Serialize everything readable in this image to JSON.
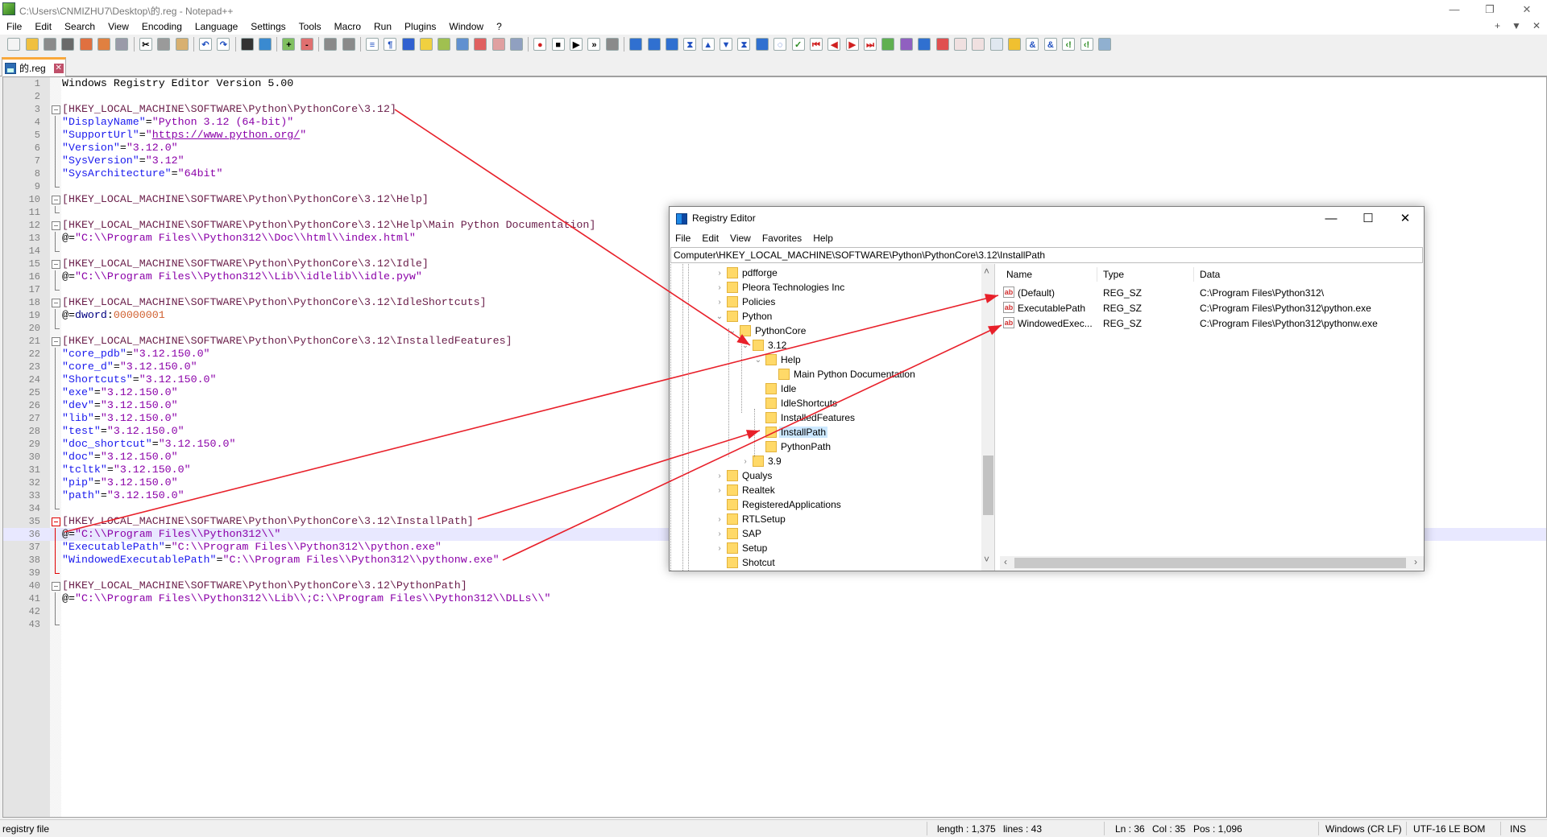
{
  "window": {
    "title": "C:\\Users\\CNMIZHU7\\Desktop\\的.reg - Notepad++",
    "controls": {
      "minimize": "—",
      "restore": "❐",
      "close": "✕"
    },
    "secondary_controls": {
      "add": "+",
      "dropdown": "▼",
      "close": "✕"
    }
  },
  "menu": [
    "File",
    "Edit",
    "Search",
    "View",
    "Encoding",
    "Language",
    "Settings",
    "Tools",
    "Macro",
    "Run",
    "Plugins",
    "Window",
    "?"
  ],
  "toolbar": [
    {
      "name": "new-file-icon",
      "glyph": "",
      "color": "#f4f4f4"
    },
    {
      "name": "open-file-icon",
      "glyph": "",
      "color": "#f0c040"
    },
    {
      "name": "save-icon",
      "glyph": "",
      "color": "#8a8a8a"
    },
    {
      "name": "save-all-icon",
      "glyph": "",
      "color": "#6a6a6a"
    },
    {
      "name": "close-icon",
      "glyph": "",
      "color": "#e07040"
    },
    {
      "name": "close-all-icon",
      "glyph": "",
      "color": "#e08040"
    },
    {
      "name": "print-icon",
      "glyph": "",
      "color": "#9a9aa8"
    },
    "sep",
    {
      "name": "cut-icon",
      "glyph": "✂",
      "color": "#ffffff"
    },
    {
      "name": "copy-icon",
      "glyph": "",
      "color": "#9a9a9a"
    },
    {
      "name": "paste-icon",
      "glyph": "",
      "color": "#d8b070"
    },
    "sep",
    {
      "name": "undo-icon",
      "glyph": "↶",
      "color": "#ffffff"
    },
    {
      "name": "redo-icon",
      "glyph": "↷",
      "color": "#ffffff"
    },
    "sep",
    {
      "name": "find-icon",
      "glyph": "",
      "color": "#333333"
    },
    {
      "name": "replace-icon",
      "glyph": "",
      "color": "#3a8ad0"
    },
    "sep",
    {
      "name": "zoom-in-icon",
      "glyph": "+",
      "color": "#80c060"
    },
    {
      "name": "zoom-out-icon",
      "glyph": "-",
      "color": "#e07070"
    },
    "sep",
    {
      "name": "sync-vertical-icon",
      "glyph": "",
      "color": "#8a8a8a"
    },
    {
      "name": "sync-horizontal-icon",
      "glyph": "",
      "color": "#8a8a8a"
    },
    "sep",
    {
      "name": "word-wrap-icon",
      "glyph": "≡",
      "color": "#ffffff"
    },
    {
      "name": "show-all-chars-icon",
      "glyph": "¶",
      "color": "#ffffff"
    },
    {
      "name": "indent-guide-icon",
      "glyph": "",
      "color": "#3060d0"
    },
    {
      "name": "udl-icon",
      "glyph": "",
      "color": "#f0d040"
    },
    {
      "name": "doc-map-icon",
      "glyph": "",
      "color": "#a0c050"
    },
    {
      "name": "doc-list-icon",
      "glyph": "",
      "color": "#6090d0"
    },
    {
      "name": "function-list-icon",
      "glyph": "",
      "color": "#e06060"
    },
    {
      "name": "folder-workspace-icon",
      "glyph": "",
      "color": "#e0a0a0"
    },
    {
      "name": "monitoring-icon",
      "glyph": "",
      "color": "#90a0c0"
    },
    "sep",
    {
      "name": "record-macro-icon",
      "glyph": "●",
      "color": "#ffffff"
    },
    {
      "name": "stop-macro-icon",
      "glyph": "■",
      "color": "#ffffff"
    },
    {
      "name": "play-macro-icon",
      "glyph": "▶",
      "color": "#ffffff"
    },
    {
      "name": "run-macro-multiple-icon",
      "glyph": "»",
      "color": "#ffffff"
    },
    {
      "name": "save-macro-icon",
      "glyph": "",
      "color": "#8a8a8a"
    },
    "sep",
    {
      "name": "plugin-1-icon",
      "glyph": "",
      "color": "#3070d0"
    },
    {
      "name": "plugin-2-icon",
      "glyph": "",
      "color": "#3070d0"
    },
    {
      "name": "plugin-3-icon",
      "glyph": "",
      "color": "#3070d0"
    },
    {
      "name": "collapse-up-icon",
      "glyph": "⧗",
      "color": "#ffffff"
    },
    {
      "name": "triangle-up-icon",
      "glyph": "▲",
      "color": "#ffffff"
    },
    {
      "name": "triangle-down-icon",
      "glyph": "▼",
      "color": "#ffffff"
    },
    {
      "name": "collapse-down-icon",
      "glyph": "⧗",
      "color": "#ffffff"
    },
    {
      "name": "compare-icon",
      "glyph": "",
      "color": "#3070d0"
    },
    {
      "name": "sync-icon",
      "glyph": "◌",
      "color": "#ffffff"
    },
    {
      "name": "check-icon",
      "glyph": "✓",
      "color": "#ffffff"
    },
    {
      "name": "first-diff-icon",
      "glyph": "⏮",
      "color": "#ffffff"
    },
    {
      "name": "prev-diff-icon",
      "glyph": "◀",
      "color": "#ffffff"
    },
    {
      "name": "next-diff-icon",
      "glyph": "▶",
      "color": "#ffffff"
    },
    {
      "name": "last-diff-icon",
      "glyph": "⏭",
      "color": "#ffffff"
    },
    {
      "name": "doc-green-icon",
      "glyph": "",
      "color": "#60b050"
    },
    {
      "name": "doc-purple-icon",
      "glyph": "",
      "color": "#9060c0"
    },
    {
      "name": "doc-blue-icon",
      "glyph": "",
      "color": "#3070d0"
    },
    {
      "name": "filter-icon",
      "glyph": "",
      "color": "#e05050"
    },
    {
      "name": "doc-lines-icon",
      "glyph": "",
      "color": "#f0e0e0"
    },
    {
      "name": "doc-lines-2-icon",
      "glyph": "",
      "color": "#f0e0e0"
    },
    {
      "name": "doc-search-icon",
      "glyph": "",
      "color": "#e0e8f0"
    },
    {
      "name": "lightning-icon",
      "glyph": "",
      "color": "#f0c030"
    },
    {
      "name": "ampersand-icon",
      "glyph": "&",
      "color": "#ffffff"
    },
    {
      "name": "ampersand-off-icon",
      "glyph": "&",
      "color": "#ffffff"
    },
    {
      "name": "comment-icon",
      "glyph": "‹!",
      "color": "#ffffff"
    },
    {
      "name": "uncomment-icon",
      "glyph": "‹!",
      "color": "#ffffff"
    },
    {
      "name": "wrench-icon",
      "glyph": "",
      "color": "#90b0d0"
    }
  ],
  "tab": {
    "label": "的.reg"
  },
  "editor": {
    "current_line": 36,
    "lines": [
      [
        [
          "p",
          "Windows Registry Editor Version 5.00"
        ]
      ],
      [],
      [
        [
          "k",
          "[HKEY_LOCAL_MACHINE\\SOFTWARE\\Python\\PythonCore\\3.12]"
        ]
      ],
      [
        [
          "n",
          "\"DisplayName\""
        ],
        [
          "o",
          "="
        ],
        [
          "v",
          "\"Python 3.12 (64-bit)\""
        ]
      ],
      [
        [
          "n",
          "\"SupportUrl\""
        ],
        [
          "o",
          "="
        ],
        [
          "v",
          "\""
        ],
        [
          "u",
          "https://www.python.org/"
        ],
        [
          "v",
          "\""
        ]
      ],
      [
        [
          "n",
          "\"Version\""
        ],
        [
          "o",
          "="
        ],
        [
          "v",
          "\"3.12.0\""
        ]
      ],
      [
        [
          "n",
          "\"SysVersion\""
        ],
        [
          "o",
          "="
        ],
        [
          "v",
          "\"3.12\""
        ]
      ],
      [
        [
          "n",
          "\"SysArchitecture\""
        ],
        [
          "o",
          "="
        ],
        [
          "v",
          "\"64bit\""
        ]
      ],
      [],
      [
        [
          "k",
          "[HKEY_LOCAL_MACHINE\\SOFTWARE\\Python\\PythonCore\\3.12\\Help]"
        ]
      ],
      [],
      [
        [
          "k",
          "[HKEY_LOCAL_MACHINE\\SOFTWARE\\Python\\PythonCore\\3.12\\Help\\Main Python Documentation]"
        ]
      ],
      [
        [
          "o",
          "@="
        ],
        [
          "v",
          "\"C:\\\\Program Files\\\\Python312\\\\Doc\\\\html\\\\index.html\""
        ]
      ],
      [],
      [
        [
          "k",
          "[HKEY_LOCAL_MACHINE\\SOFTWARE\\Python\\PythonCore\\3.12\\Idle]"
        ]
      ],
      [
        [
          "o",
          "@="
        ],
        [
          "v",
          "\"C:\\\\Program Files\\\\Python312\\\\Lib\\\\idlelib\\\\idle.pyw\""
        ]
      ],
      [],
      [
        [
          "k",
          "[HKEY_LOCAL_MACHINE\\SOFTWARE\\Python\\PythonCore\\3.12\\IdleShortcuts]"
        ]
      ],
      [
        [
          "o",
          "@="
        ],
        [
          "d",
          "dword"
        ],
        [
          "o",
          ":"
        ],
        [
          "h",
          "00000001"
        ]
      ],
      [],
      [
        [
          "k",
          "[HKEY_LOCAL_MACHINE\\SOFTWARE\\Python\\PythonCore\\3.12\\InstalledFeatures]"
        ]
      ],
      [
        [
          "n",
          "\"core_pdb\""
        ],
        [
          "o",
          "="
        ],
        [
          "v",
          "\"3.12.150.0\""
        ]
      ],
      [
        [
          "n",
          "\"core_d\""
        ],
        [
          "o",
          "="
        ],
        [
          "v",
          "\"3.12.150.0\""
        ]
      ],
      [
        [
          "n",
          "\"Shortcuts\""
        ],
        [
          "o",
          "="
        ],
        [
          "v",
          "\"3.12.150.0\""
        ]
      ],
      [
        [
          "n",
          "\"exe\""
        ],
        [
          "o",
          "="
        ],
        [
          "v",
          "\"3.12.150.0\""
        ]
      ],
      [
        [
          "n",
          "\"dev\""
        ],
        [
          "o",
          "="
        ],
        [
          "v",
          "\"3.12.150.0\""
        ]
      ],
      [
        [
          "n",
          "\"lib\""
        ],
        [
          "o",
          "="
        ],
        [
          "v",
          "\"3.12.150.0\""
        ]
      ],
      [
        [
          "n",
          "\"test\""
        ],
        [
          "o",
          "="
        ],
        [
          "v",
          "\"3.12.150.0\""
        ]
      ],
      [
        [
          "n",
          "\"doc_shortcut\""
        ],
        [
          "o",
          "="
        ],
        [
          "v",
          "\"3.12.150.0\""
        ]
      ],
      [
        [
          "n",
          "\"doc\""
        ],
        [
          "o",
          "="
        ],
        [
          "v",
          "\"3.12.150.0\""
        ]
      ],
      [
        [
          "n",
          "\"tcltk\""
        ],
        [
          "o",
          "="
        ],
        [
          "v",
          "\"3.12.150.0\""
        ]
      ],
      [
        [
          "n",
          "\"pip\""
        ],
        [
          "o",
          "="
        ],
        [
          "v",
          "\"3.12.150.0\""
        ]
      ],
      [
        [
          "n",
          "\"path\""
        ],
        [
          "o",
          "="
        ],
        [
          "v",
          "\"3.12.150.0\""
        ]
      ],
      [],
      [
        [
          "k",
          "[HKEY_LOCAL_MACHINE\\SOFTWARE\\Python\\PythonCore\\3.12\\InstallPath]"
        ]
      ],
      [
        [
          "o",
          "@="
        ],
        [
          "v",
          "\"C:\\\\Program Files\\\\Python312\\\\\""
        ]
      ],
      [
        [
          "n",
          "\"ExecutablePath\""
        ],
        [
          "o",
          "="
        ],
        [
          "v",
          "\"C:\\\\Program Files\\\\Python312\\\\python.exe\""
        ]
      ],
      [
        [
          "n",
          "\"WindowedExecutablePath\""
        ],
        [
          "o",
          "="
        ],
        [
          "v",
          "\"C:\\\\Program Files\\\\Python312\\\\pythonw.exe\""
        ]
      ],
      [],
      [
        [
          "k",
          "[HKEY_LOCAL_MACHINE\\SOFTWARE\\Python\\PythonCore\\3.12\\PythonPath]"
        ]
      ],
      [
        [
          "o",
          "@="
        ],
        [
          "v",
          "\"C:\\\\Program Files\\\\Python312\\\\Lib\\\\;C:\\\\Program Files\\\\Python312\\\\DLLs\\\\\""
        ]
      ],
      [],
      []
    ]
  },
  "statusbar": {
    "file_type": "registry file",
    "length": "length : 1,375",
    "lines": "lines : 43",
    "ln": "Ln : 36",
    "col": "Col : 35",
    "pos": "Pos : 1,096",
    "eol": "Windows (CR LF)",
    "encoding": "UTF-16 LE BOM",
    "mode": "INS"
  },
  "regedit": {
    "title": "Registry Editor",
    "controls": {
      "minimize": "—",
      "maximize": "☐",
      "close": "✕"
    },
    "menu": [
      "File",
      "Edit",
      "View",
      "Favorites",
      "Help"
    ],
    "address": "Computer\\HKEY_LOCAL_MACHINE\\SOFTWARE\\Python\\PythonCore\\3.12\\InstallPath",
    "tree": [
      {
        "label": "pdfforge",
        "level": 0,
        "exp": "›"
      },
      {
        "label": "Pleora Technologies Inc",
        "level": 0,
        "exp": "›"
      },
      {
        "label": "Policies",
        "level": 0,
        "exp": "›"
      },
      {
        "label": "Python",
        "level": 0,
        "exp": "⌄"
      },
      {
        "label": "PythonCore",
        "level": 1,
        "exp": "⌄"
      },
      {
        "label": "3.12",
        "level": 2,
        "exp": "⌄"
      },
      {
        "label": "Help",
        "level": 3,
        "exp": "⌄"
      },
      {
        "label": "Main Python Documentation",
        "level": 4,
        "exp": ""
      },
      {
        "label": "Idle",
        "level": 3,
        "exp": ""
      },
      {
        "label": "IdleShortcuts",
        "level": 3,
        "exp": ""
      },
      {
        "label": "InstalledFeatures",
        "level": 3,
        "exp": ""
      },
      {
        "label": "InstallPath",
        "level": 3,
        "exp": "",
        "selected": true
      },
      {
        "label": "PythonPath",
        "level": 3,
        "exp": ""
      },
      {
        "label": "3.9",
        "level": 2,
        "exp": "›"
      },
      {
        "label": "Qualys",
        "level": 0,
        "exp": "›"
      },
      {
        "label": "Realtek",
        "level": 0,
        "exp": "›"
      },
      {
        "label": "RegisteredApplications",
        "level": 0,
        "exp": ""
      },
      {
        "label": "RTLSetup",
        "level": 0,
        "exp": "›"
      },
      {
        "label": "SAP",
        "level": 0,
        "exp": "›"
      },
      {
        "label": "Setup",
        "level": 0,
        "exp": "›"
      },
      {
        "label": "Shotcut",
        "level": 0,
        "exp": ""
      }
    ],
    "columns": [
      "Name",
      "Type",
      "Data"
    ],
    "values": [
      {
        "name": "(Default)",
        "type": "REG_SZ",
        "data": "C:\\Program Files\\Python312\\"
      },
      {
        "name": "ExecutablePath",
        "type": "REG_SZ",
        "data": "C:\\Program Files\\Python312\\python.exe"
      },
      {
        "name": "WindowedExec...",
        "type": "REG_SZ",
        "data": "C:\\Program Files\\Python312\\pythonw.exe"
      }
    ],
    "value_icon": "ab",
    "scroll": {
      "up": "˄",
      "down": "˅",
      "left": "‹",
      "right": "›"
    }
  },
  "annotation_color": "#e8202a"
}
